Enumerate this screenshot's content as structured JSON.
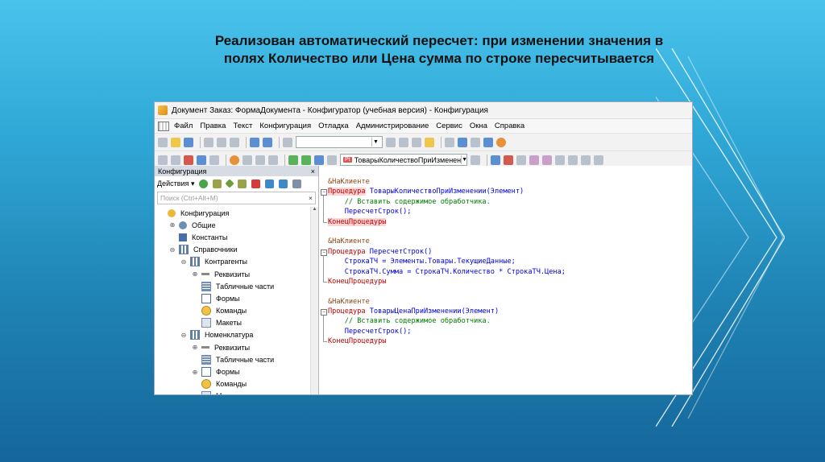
{
  "slide": {
    "title_line1": "Реализован автоматический пересчет: при изменении значения в",
    "title_line2": "полях Количество или Цена сумма по строке пересчитывается"
  },
  "window": {
    "title": "Документ Заказ: ФормаДокумента - Конфигуратор (учебная версия) - Конфигурация"
  },
  "menu": [
    "Файл",
    "Правка",
    "Текст",
    "Конфигурация",
    "Отладка",
    "Администрирование",
    "Сервис",
    "Окна",
    "Справка"
  ],
  "toolbar": {
    "procedure_combo": "ТоварыКоличествоПриИзменен",
    "procedure_tag": "Pt"
  },
  "panel": {
    "title": "Конфигурация",
    "close": "×",
    "actions_label": "Действия",
    "search_placeholder": "Поиск (Ctrl+Alt+M)",
    "search_clear": "×"
  },
  "tree": [
    {
      "label": "Конфигурация",
      "indent": 0,
      "exp": "",
      "icon": "cfg"
    },
    {
      "label": "Общие",
      "indent": 1,
      "exp": "⊕",
      "icon": "common"
    },
    {
      "label": "Константы",
      "indent": 1,
      "exp": "",
      "icon": "const"
    },
    {
      "label": "Справочники",
      "indent": 1,
      "exp": "⊖",
      "icon": "ref"
    },
    {
      "label": "Контрагенты",
      "indent": 2,
      "exp": "⊖",
      "icon": "ref"
    },
    {
      "label": "Реквизиты",
      "indent": 3,
      "exp": "⊕",
      "icon": "req"
    },
    {
      "label": "Табличные части",
      "indent": 3,
      "exp": "",
      "icon": "tab"
    },
    {
      "label": "Формы",
      "indent": 3,
      "exp": "",
      "icon": "form"
    },
    {
      "label": "Команды",
      "indent": 3,
      "exp": "",
      "icon": "cmd"
    },
    {
      "label": "Макеты",
      "indent": 3,
      "exp": "",
      "icon": "mk"
    },
    {
      "label": "Номенклатура",
      "indent": 2,
      "exp": "⊖",
      "icon": "ref"
    },
    {
      "label": "Реквизиты",
      "indent": 3,
      "exp": "⊕",
      "icon": "req"
    },
    {
      "label": "Табличные части",
      "indent": 3,
      "exp": "",
      "icon": "tab"
    },
    {
      "label": "Формы",
      "indent": 3,
      "exp": "⊕",
      "icon": "form"
    },
    {
      "label": "Команды",
      "indent": 3,
      "exp": "",
      "icon": "cmd"
    },
    {
      "label": "Макеты",
      "indent": 3,
      "exp": "",
      "icon": "mk"
    }
  ],
  "code": [
    [
      [
        "&НаКлиенте",
        "dir"
      ]
    ],
    [
      [
        "Процедура",
        "kw hl"
      ],
      [
        " ТоварыКоличествоПриИзменении(Элемент)",
        "fn"
      ]
    ],
    [
      [
        "    // Вставить содержимое обработчика.",
        "cm"
      ]
    ],
    [
      [
        "    ПересчетСтрок();",
        "fn"
      ]
    ],
    [
      [
        "КонецПроцедуры",
        "kw hl"
      ]
    ],
    [
      [
        "",
        ""
      ]
    ],
    [
      [
        "&НаКлиенте",
        "dir"
      ]
    ],
    [
      [
        "Процедура",
        "kw"
      ],
      [
        " ПересчетСтрок()",
        "fn"
      ]
    ],
    [
      [
        "    СтрокаТЧ = Элементы.Товары.ТекущиеДанные;",
        "fn"
      ]
    ],
    [
      [
        "    СтрокаТЧ.Сумма = СтрокаТЧ.Количество * СтрокаТЧ.Цена;",
        "fn"
      ]
    ],
    [
      [
        "КонецПроцедуры",
        "kw"
      ]
    ],
    [
      [
        "",
        ""
      ]
    ],
    [
      [
        "&НаКлиенте",
        "dir"
      ]
    ],
    [
      [
        "Процедура",
        "kw"
      ],
      [
        " ТоварыЦенаПриИзменении(Элемент)",
        "fn"
      ]
    ],
    [
      [
        "    // Вставить содержимое обработчика.",
        "cm"
      ]
    ],
    [
      [
        "    ПересчетСтрок();",
        "fn"
      ]
    ],
    [
      [
        "КонецПроцедуры",
        "kw"
      ]
    ]
  ]
}
